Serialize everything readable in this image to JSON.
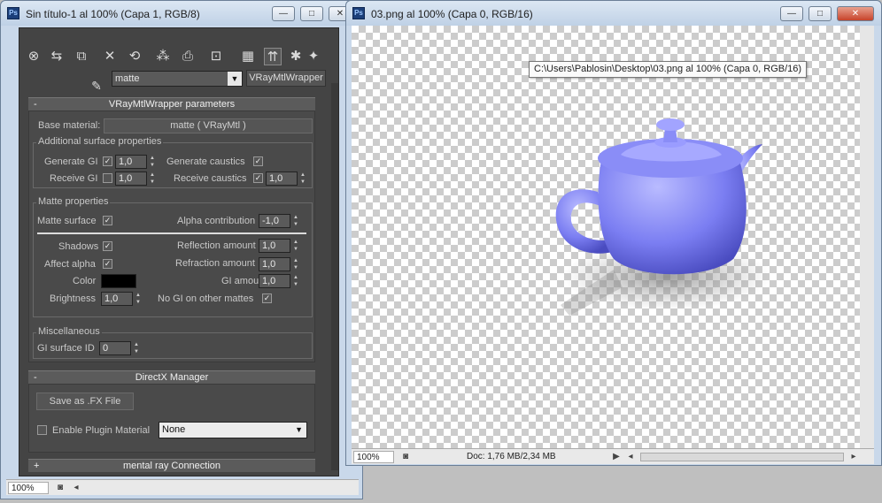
{
  "left_window": {
    "title": "Sin título-1 al 100% (Capa 1, RGB/8)",
    "zoom": "100%",
    "controls": {
      "minimize": "—",
      "maximize": "□",
      "close": "✕"
    }
  },
  "right_window": {
    "title": "03.png al 100% (Capa 0, RGB/16)",
    "tooltip": "C:\\Users\\Pablosin\\Desktop\\03.png al 100% (Capa 0, RGB/16)",
    "zoom": "100%",
    "doc_info": "Doc: 1,76 MB/2,34 MB",
    "controls": {
      "minimize": "—",
      "maximize": "□",
      "close": "✕"
    },
    "teapot_color": "#7b7ef2"
  },
  "material_editor": {
    "material_name": "matte",
    "material_type": "VRayMtlWrapper",
    "rollout_wrapper": {
      "title": "VRayMtlWrapper parameters",
      "toggle": "-",
      "base_material_label": "Base material:",
      "base_material_value": "matte  ( VRayMtl )",
      "additional": {
        "title": "Additional surface properties",
        "generate_gi_label": "Generate GI",
        "generate_gi_value": "1,0",
        "generate_gi_checked": true,
        "receive_gi_label": "Receive GI",
        "receive_gi_value": "1,0",
        "receive_gi_checked": false,
        "generate_caustics_label": "Generate caustics",
        "generate_caustics_checked": true,
        "receive_caustics_label": "Receive caustics",
        "receive_caustics_value": "1,0",
        "receive_caustics_checked": true
      },
      "matte": {
        "title": "Matte properties",
        "matte_surface_label": "Matte surface",
        "matte_surface_checked": true,
        "alpha_contribution_label": "Alpha contribution",
        "alpha_contribution_value": "-1,0",
        "shadows_label": "Shadows",
        "shadows_checked": true,
        "affect_alpha_label": "Affect alpha",
        "affect_alpha_checked": true,
        "color_label": "Color",
        "color_value": "#000000",
        "brightness_label": "Brightness",
        "brightness_value": "1,0",
        "reflection_amount_label": "Reflection amount",
        "reflection_amount_value": "1,0",
        "refraction_amount_label": "Refraction amount",
        "refraction_amount_value": "1,0",
        "gi_amount_label": "GI amount",
        "gi_amount_value": "1,0",
        "no_gi_label": "No GI on other mattes",
        "no_gi_checked": true
      },
      "misc": {
        "title": "Miscellaneous",
        "gi_surface_id_label": "GI surface ID",
        "gi_surface_id_value": "0"
      }
    },
    "rollout_directx": {
      "title": "DirectX Manager",
      "toggle": "-",
      "save_fx_label": "Save as .FX File",
      "enable_plugin_label": "Enable Plugin Material",
      "plugin_select_value": "None"
    },
    "rollout_mentalray": {
      "title": "mental ray Connection",
      "toggle": "+"
    }
  }
}
